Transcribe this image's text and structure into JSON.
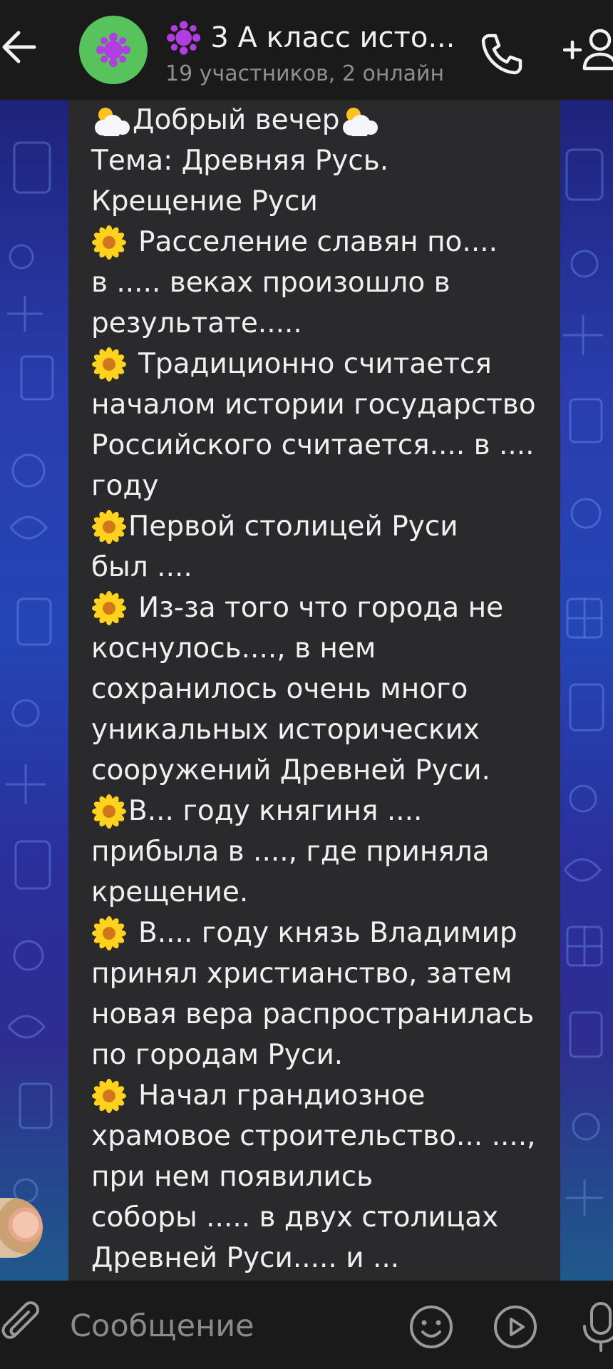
{
  "header": {
    "group_name": "3 А класс исто...",
    "subtitle": "19 участников, 2 онлайн",
    "group_avatar_icon": "paint-splash-icon",
    "actions": [
      "back-arrow-icon",
      "phone-icon",
      "add-member-icon"
    ]
  },
  "message": {
    "lines": [
      {
        "icon": "cloud-sun",
        "text": "Добрый вечер",
        "trail_icon": "cloud-sun"
      },
      {
        "text": "Тема: Древняя Русь."
      },
      {
        "text": "Крещение Руси"
      },
      {
        "icon": "daisy",
        "gap": true,
        "text": "Расселение славян по...."
      },
      {
        "text": "в ..... веках произошло в"
      },
      {
        "text": "результате....."
      },
      {
        "icon": "daisy",
        "gap": true,
        "text": "Традиционно считается"
      },
      {
        "text": "началом истории государство"
      },
      {
        "text": "Российского считается.... в ...."
      },
      {
        "text": "году"
      },
      {
        "icon": "daisy",
        "text": "Первой столицей Руси"
      },
      {
        "text": "был ...."
      },
      {
        "icon": "daisy",
        "gap": true,
        "text": "Из-за того что города не"
      },
      {
        "text": "коснулось...., в нем"
      },
      {
        "text": "сохранилось очень много"
      },
      {
        "text": "уникальных исторических"
      },
      {
        "text": "сооружений Древней Руси."
      },
      {
        "icon": "daisy",
        "text": "В... году княгиня ...."
      },
      {
        "text": "прибыла в ...., где приняла"
      },
      {
        "text": "крещение."
      },
      {
        "icon": "daisy",
        "gap": true,
        "text": "В.... году князь Владимир"
      },
      {
        "text": "принял христианство, затем"
      },
      {
        "text": "новая вера распространилась"
      },
      {
        "text": "по городам Руси."
      },
      {
        "icon": "daisy",
        "gap": true,
        "text": "Начал грандиозное"
      },
      {
        "text": "храмовое строительство... ....,"
      },
      {
        "text": "при нем появились"
      },
      {
        "text": "соборы ..... в двух столицах"
      },
      {
        "text": "Древней Руси..... и ..."
      }
    ]
  },
  "composer": {
    "placeholder": "Сообщение",
    "icons": [
      "paperclip-icon",
      "smiley-icon",
      "video-message-icon",
      "microphone-icon"
    ]
  },
  "colors": {
    "header_bg": "#1a1a1a",
    "bubble_bg": "#2a2a2c",
    "group_avatar_bg": "#58c35c",
    "chat_bg_top": "#1e237a",
    "chat_bg_mid": "#2446b5",
    "text_primary": "#f0f0f0",
    "text_muted": "#8f8f8f"
  }
}
